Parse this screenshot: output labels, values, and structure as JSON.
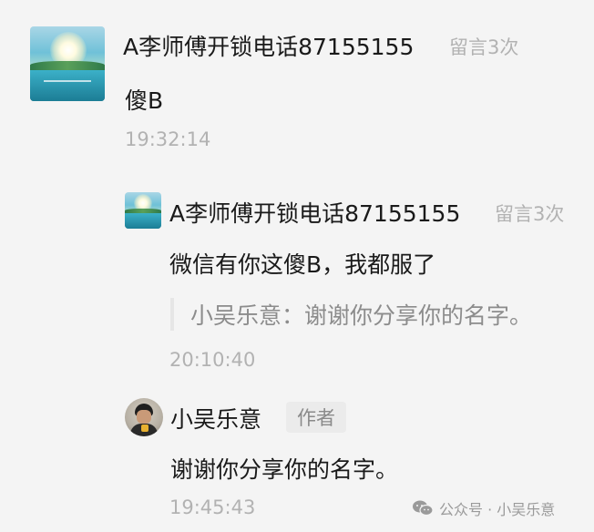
{
  "comment": {
    "author": "A李师傅开锁电话87155155",
    "count": "留言3次",
    "text": "傻B",
    "time": "19:32:14"
  },
  "reply1": {
    "author": "A李师傅开锁电话87155155",
    "count": "留言3次",
    "text": "微信有你这傻B，我都服了",
    "quote": "小吴乐意：谢谢你分享你的名字。",
    "time": "20:10:40"
  },
  "reply2": {
    "author": "小吴乐意",
    "badge": "作者",
    "text": "谢谢你分享你的名字。",
    "time": "19:45:43"
  },
  "watermark": {
    "icon": "wechat-icon",
    "text": "公众号 · 小吴乐意"
  }
}
